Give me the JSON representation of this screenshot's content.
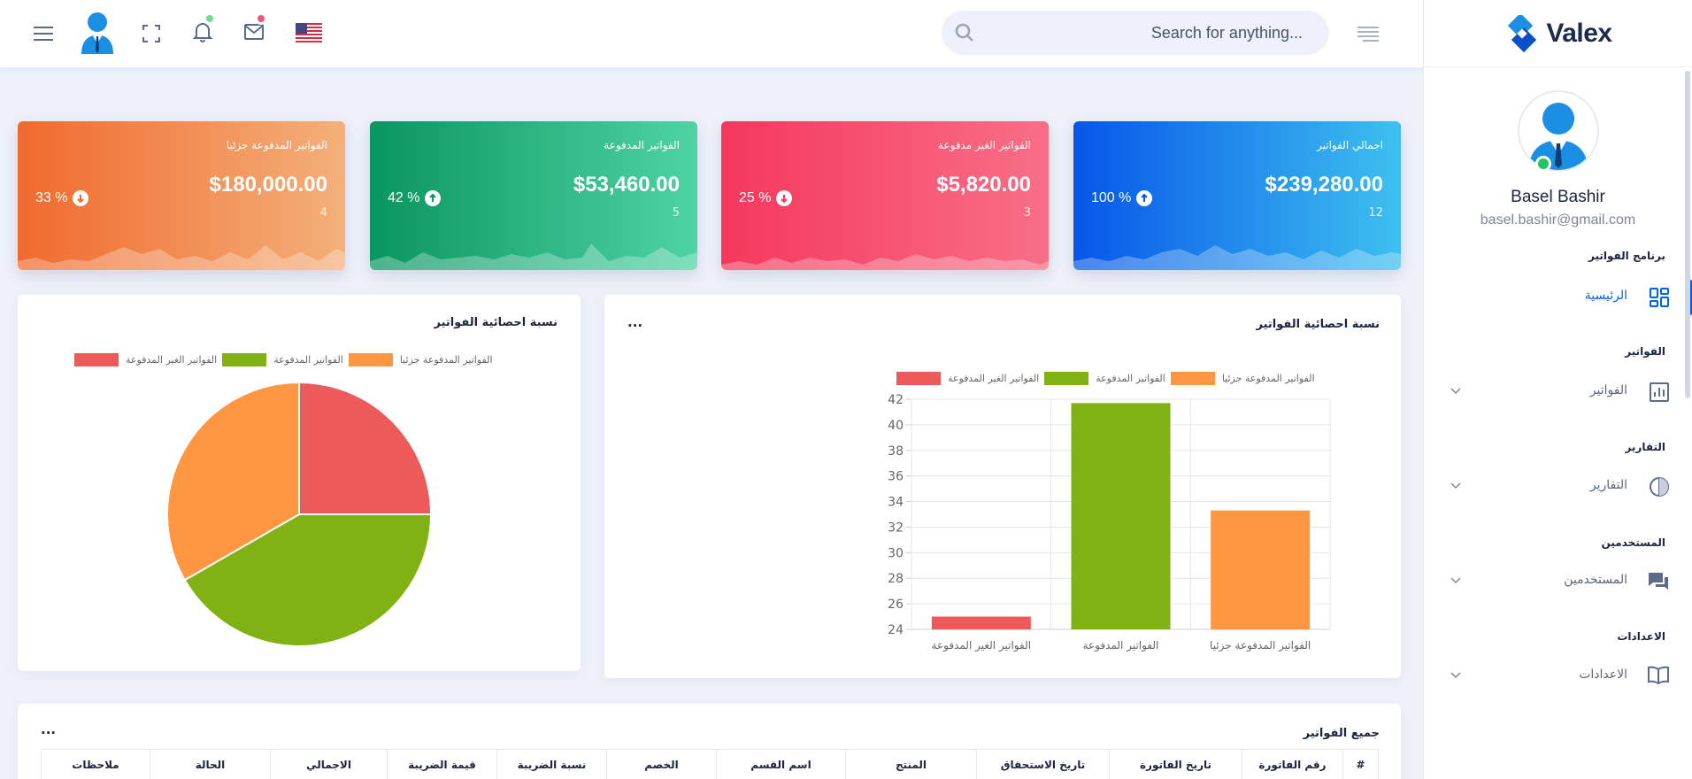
{
  "header": {
    "search_placeholder": "Search for anything...",
    "notification_dot_color": "#6fdd8a",
    "mail_dot_color": "#f0577b"
  },
  "brand": {
    "name": "Valex"
  },
  "user": {
    "name": "Basel Bashir",
    "email": "basel.bashir@gmail.com"
  },
  "sidebar": {
    "sections": [
      {
        "title": "برنامج الفواتير",
        "item": {
          "label": "الرئيسية",
          "icon": "dashboard-icon",
          "active": true,
          "has_chevron": false
        }
      },
      {
        "title": "الفواتير",
        "item": {
          "label": "الفواتير",
          "icon": "chart-icon",
          "active": false,
          "has_chevron": true
        }
      },
      {
        "title": "التقارير",
        "item": {
          "label": "التقارير",
          "icon": "pie-icon",
          "active": false,
          "has_chevron": true
        }
      },
      {
        "title": "المستخدمين",
        "item": {
          "label": "المستخدمين",
          "icon": "chat-icon",
          "active": false,
          "has_chevron": true
        }
      },
      {
        "title": "الاعدادات",
        "item": {
          "label": "الاعدادات",
          "icon": "book-icon",
          "active": false,
          "has_chevron": true
        }
      }
    ]
  },
  "cards": [
    {
      "title": "اجمالي الفواتير",
      "amount": "$239,280.00",
      "count": "12",
      "percent": "100 %",
      "trend": "up",
      "color": "blue"
    },
    {
      "title": "الفواتير الغير مدفوعة",
      "amount": "$5,820.00",
      "count": "3",
      "percent": "25 %",
      "trend": "down",
      "color": "red"
    },
    {
      "title": "الفواتير المدفوعة",
      "amount": "$53,460.00",
      "count": "5",
      "percent": "42 %",
      "trend": "up",
      "color": "green"
    },
    {
      "title": "الفواتير المدفوعة جزئيا",
      "amount": "$180,000.00",
      "count": "4",
      "percent": "33 %",
      "trend": "down",
      "color": "orange"
    }
  ],
  "bar_panel": {
    "title": "نسبة احصائية الفواتير",
    "menu": "..."
  },
  "pie_panel": {
    "title": "نسبة احصائية الفواتير"
  },
  "table": {
    "title": "جميع الفواتير",
    "menu": "...",
    "columns": [
      "#",
      "رقم الفاتورة",
      "تاريخ الفاتورة",
      "تاريخ الاستحقاق",
      "المنتج",
      "اسم القسم",
      "الخصم",
      "نسبة الضريبة",
      "قيمة الضريبة",
      "الاجمالي",
      "الحالة",
      "ملاحظات"
    ]
  },
  "chart_data": [
    {
      "type": "bar",
      "title": "نسبة احصائية الفواتير",
      "categories": [
        "الفواتير الغير المدفوعة",
        "الفواتير المدفوعة",
        "الفواتير المدفوعة جزئيا"
      ],
      "series": [
        {
          "name": "الفواتير الغير المدفوعة",
          "color": "#ec5a5a",
          "values": [
            25,
            null,
            null
          ]
        },
        {
          "name": "الفواتير المدفوعة",
          "color": "#81b214",
          "values": [
            null,
            41.7,
            null
          ]
        },
        {
          "name": "الفواتير المدفوعة جزئيا",
          "color": "#ff9642",
          "values": [
            null,
            null,
            33.3
          ]
        }
      ],
      "yticks": [
        "24",
        "26",
        "28",
        "30",
        "32",
        "34",
        "36",
        "38",
        "40",
        "42"
      ],
      "ylim": [
        24,
        42
      ],
      "grid": true,
      "legend": "top"
    },
    {
      "type": "pie",
      "title": "نسبة احصائية الفواتير",
      "labels": [
        "الفواتير الغير المدفوعة",
        "الفواتير المدفوعة",
        "الفواتير المدفوعة جزئيا"
      ],
      "values": [
        25,
        41.7,
        33.3
      ],
      "colors": [
        "#ec5a5a",
        "#81b214",
        "#ff9642"
      ],
      "legend": "top"
    }
  ]
}
